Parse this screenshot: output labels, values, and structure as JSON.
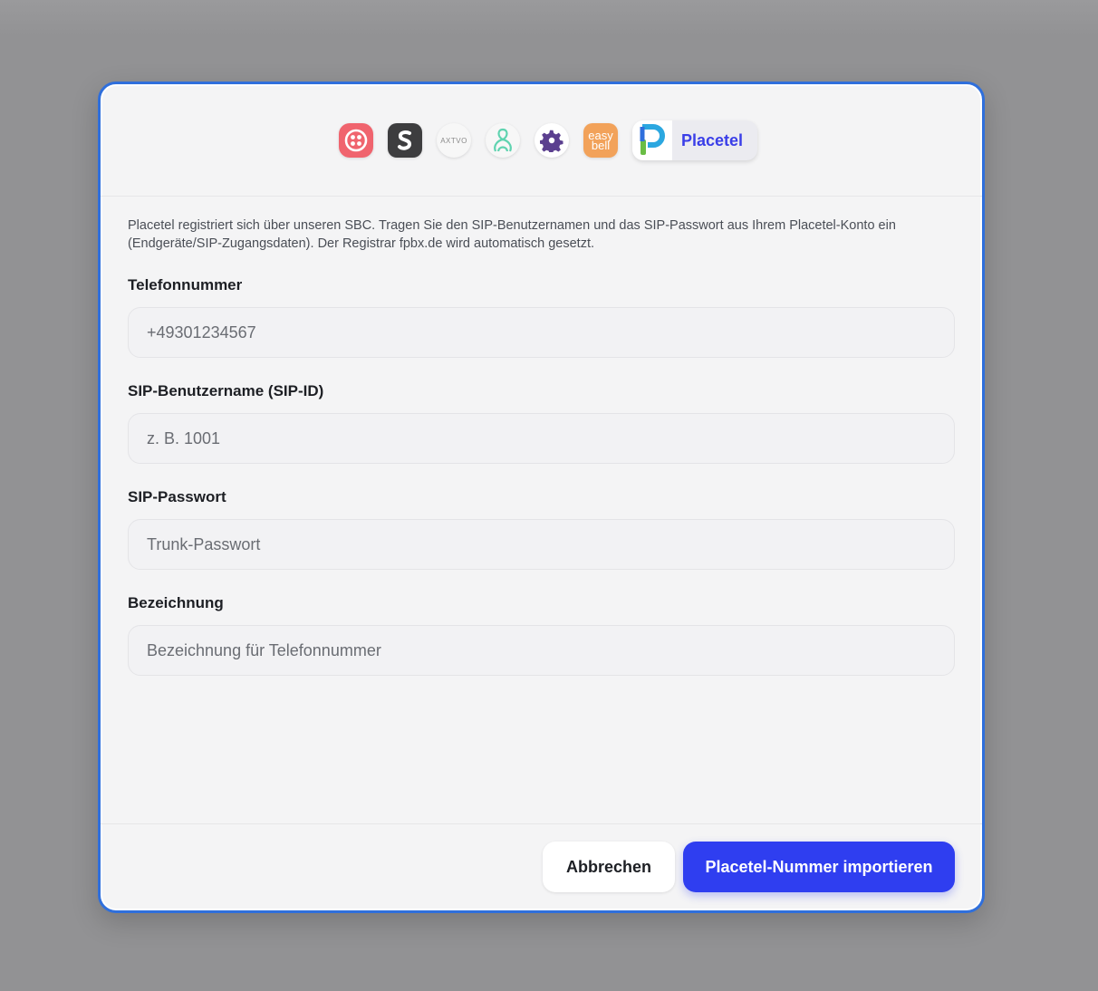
{
  "providers": [
    {
      "name": "twilio",
      "icon": "twilio-icon"
    },
    {
      "name": "sipgate",
      "icon": "sipgate-icon"
    },
    {
      "name": "axvoice",
      "icon": "axvoice-logo",
      "logo_text": "AXTVO"
    },
    {
      "name": "pbx",
      "icon": "network-icon"
    },
    {
      "name": "settings",
      "icon": "gear-icon"
    },
    {
      "name": "easybell",
      "icon": "easybell-logo",
      "logo_text": "easy bell"
    },
    {
      "name": "placetel",
      "icon": "placetel-logo",
      "label": "Placetel",
      "active": true
    }
  ],
  "info_text": "Placetel registriert sich über unseren SBC. Tragen Sie den SIP-Benutzernamen und das SIP-Passwort aus Ihrem Placetel-Konto ein (Endgeräte/SIP-Zugangsdaten). Der Registrar fpbx.de wird automatisch gesetzt.",
  "form": {
    "phone": {
      "label": "Telefonnummer",
      "placeholder": "+49301234567",
      "value": ""
    },
    "sip_user": {
      "label": "SIP-Benutzername (SIP-ID)",
      "placeholder": "z. B. 1001",
      "value": ""
    },
    "sip_password": {
      "label": "SIP-Passwort",
      "placeholder": "Trunk-Passwort",
      "value": ""
    },
    "description": {
      "label": "Bezeichnung",
      "placeholder": "Bezeichnung für Telefonnummer",
      "value": ""
    }
  },
  "footer": {
    "cancel_label": "Abbrechen",
    "submit_label": "Placetel-Nummer importieren"
  },
  "colors": {
    "accent": "#2f3ef0",
    "modal_border": "#2f6fdc",
    "twilio": "#f0646e",
    "easybell": "#f2a25a"
  }
}
